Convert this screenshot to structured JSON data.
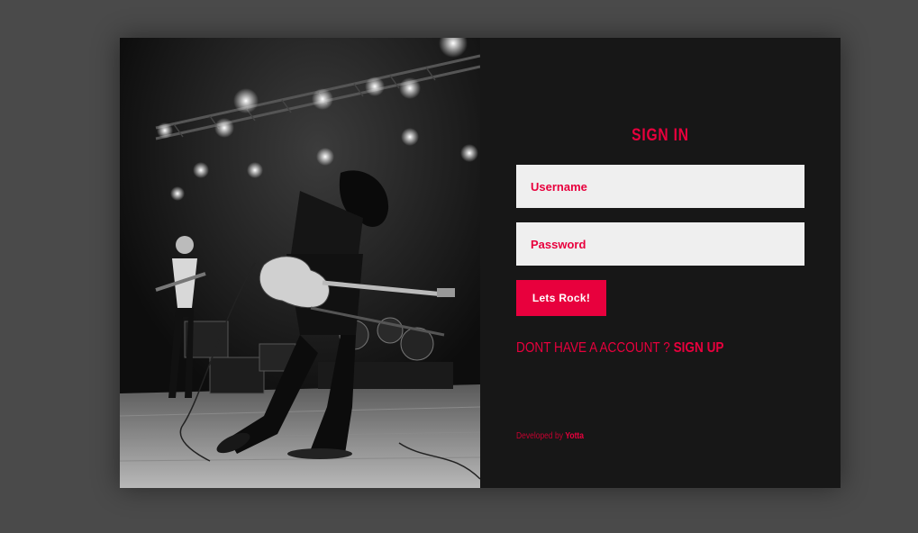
{
  "colors": {
    "accent": "#e8003d",
    "page_background": "#4a4a4a",
    "panel_background": "#171717",
    "input_background": "#efefef"
  },
  "photo": {
    "description_icon": "concert-photo-image"
  },
  "form": {
    "title": "SIGN IN",
    "username_placeholder": "Username",
    "password_placeholder": "Password",
    "submit_label": "Lets Rock!"
  },
  "signup": {
    "prompt": "DONT HAVE A ACCOUNT ?",
    "link_label": "SIGN UP"
  },
  "footer": {
    "developed_by": "Developed by",
    "brand": "Yotta"
  }
}
